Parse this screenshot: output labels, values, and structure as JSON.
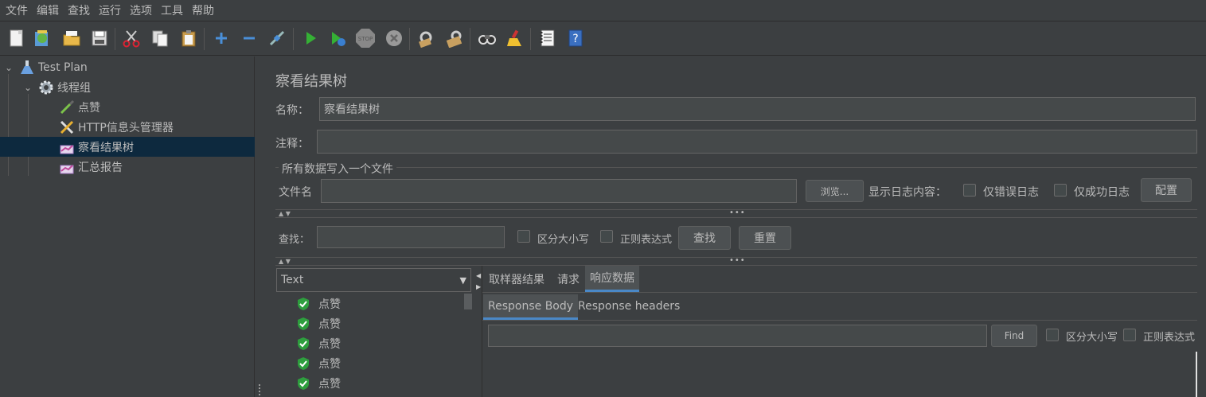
{
  "menu": [
    "文件",
    "编辑",
    "查找",
    "运行",
    "选项",
    "工具",
    "帮助"
  ],
  "toolbar_icons": [
    "new-icon",
    "templates-icon",
    "open-icon",
    "save-icon",
    "cut-icon",
    "copy-icon",
    "paste-icon",
    "expand-icon",
    "collapse-icon",
    "toggle-icon",
    "start-icon",
    "start-no-pause-icon",
    "stop-icon",
    "shutdown-icon",
    "clear-icon",
    "clear-all-icon",
    "search-icon",
    "reset-search-icon",
    "function-helper-icon",
    "help-icon"
  ],
  "tree": {
    "items": [
      {
        "label": "Test Plan"
      },
      {
        "label": "线程组"
      },
      {
        "label": "点赞"
      },
      {
        "label": "HTTP信息头管理器"
      },
      {
        "label": "察看结果树"
      },
      {
        "label": "汇总报告"
      }
    ]
  },
  "panel": {
    "title": "察看结果树",
    "name_label": "名称：",
    "name_value": "察看结果树",
    "comment_label": "注释：",
    "comment_value": "",
    "file_section_title": "所有数据写入一个文件",
    "filename_label": "文件名",
    "filename_value": "",
    "browse_button": "浏览...",
    "log_content_label": "显示日志内容：",
    "errors_only": "仅错误日志",
    "success_only": "仅成功日志",
    "config_button": "配置"
  },
  "search": {
    "label": "查找：",
    "value": "",
    "case_sensitive": "区分大小写",
    "regex": "正则表达式",
    "find_button": "查找",
    "reset_button": "重置"
  },
  "results": {
    "renderer": "Text",
    "items": [
      "点赞",
      "点赞",
      "点赞",
      "点赞",
      "点赞"
    ],
    "tabs": [
      "取样器结果",
      "请求",
      "响应数据"
    ],
    "active_tab": "响应数据",
    "sub_tabs": [
      "Response Body",
      "Response headers"
    ],
    "find_button": "Find",
    "case_sensitive": "区分大小写",
    "regex": "正则表达式"
  },
  "colors": {
    "background": "#3c3f41",
    "selection": "#0d293e",
    "accent": "#4a88c7",
    "success": "#2e9e3e"
  }
}
